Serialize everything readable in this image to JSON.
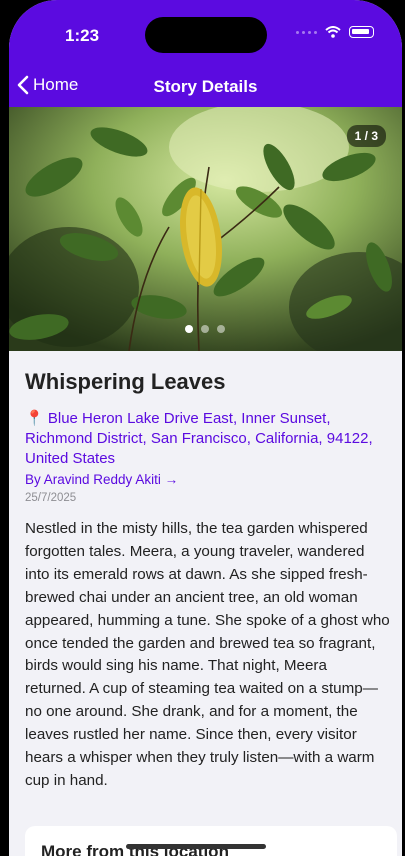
{
  "status_bar": {
    "time": "1:23"
  },
  "nav": {
    "back_label": "Home",
    "title": "Story Details"
  },
  "gallery": {
    "counter": "1 / 3",
    "current_page": 1,
    "total_pages": 3
  },
  "story": {
    "title": "Whispering Leaves",
    "location": "Blue Heron Lake Drive East, Inner Sunset, Richmond District, San Francisco, California, 94122, United States",
    "author": "By Aravind Reddy Akiti →",
    "date": "25/7/2025",
    "body": "Nestled in the misty hills, the tea garden whispered forgotten tales. Meera, a young traveler, wandered into its emerald rows at dawn. As she sipped fresh-brewed chai under an ancient tree, an old woman appeared, humming a tune. She spoke of a ghost who once tended the garden and brewed tea so fragrant, birds would sing his name. That night, Meera returned. A cup of steaming tea waited on a stump—no one around. She drank, and for a moment, the leaves rustled her name. Since then, every visitor hears a whisper when they truly listen—with a warm cup in hand."
  },
  "more_section": {
    "title": "More from this location"
  },
  "colors": {
    "accent": "#5b0be0",
    "background": "#f2f2f7"
  }
}
